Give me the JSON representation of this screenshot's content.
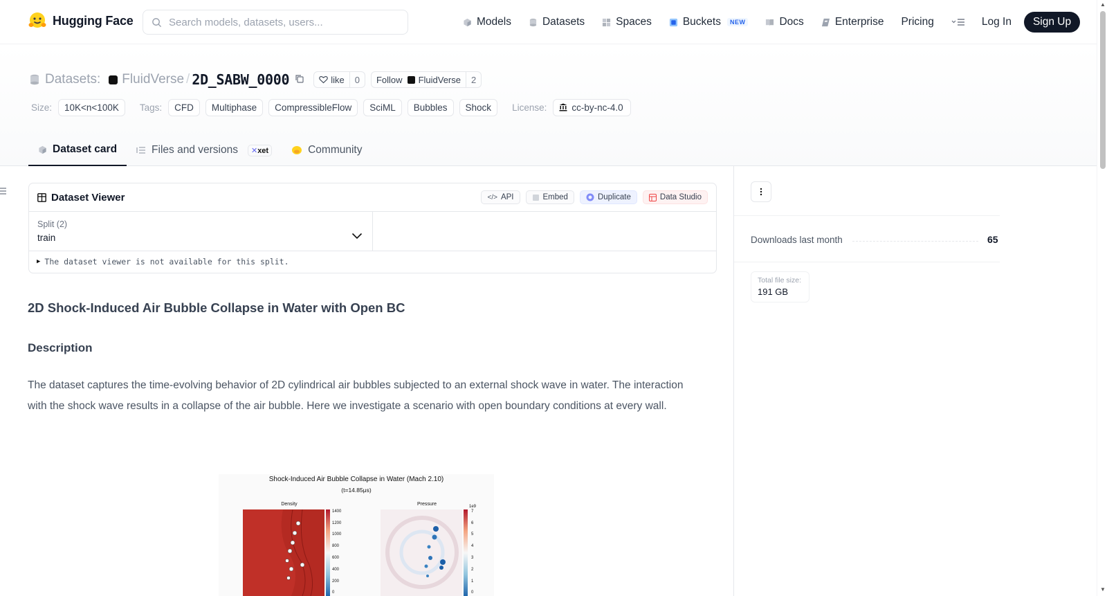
{
  "nav": {
    "brand": "Hugging Face",
    "search_placeholder": "Search models, datasets, users...",
    "links": [
      {
        "label": "Models",
        "icon": "cube-icon"
      },
      {
        "label": "Datasets",
        "icon": "database-icon"
      },
      {
        "label": "Spaces",
        "icon": "grid-icon"
      },
      {
        "label": "Buckets",
        "icon": "bucket-icon",
        "badge": "NEW"
      },
      {
        "label": "Docs",
        "icon": "book-icon"
      },
      {
        "label": "Enterprise",
        "icon": "enterprise-icon"
      },
      {
        "label": "Pricing"
      }
    ],
    "login": "Log In",
    "signup": "Sign Up"
  },
  "repo": {
    "section": "Datasets:",
    "org": "FluidVerse",
    "name": "2D_SABW_0000",
    "like_label": "like",
    "like_count": "0",
    "follow_label": "Follow",
    "follow_org": "FluidVerse",
    "follow_count": "2"
  },
  "tags": {
    "size_label": "Size:",
    "size_value": "10K<n<100K",
    "tags_label": "Tags:",
    "items": [
      "CFD",
      "Multiphase",
      "CompressibleFlow",
      "SciML",
      "Bubbles",
      "Shock"
    ],
    "license_label": "License:",
    "license_value": "cc-by-nc-4.0"
  },
  "tabs": [
    {
      "label": "Dataset card",
      "active": true
    },
    {
      "label": "Files and versions",
      "badge": "xet"
    },
    {
      "label": "Community"
    }
  ],
  "viewer": {
    "title": "Dataset Viewer",
    "buttons": [
      "API",
      "Embed",
      "Duplicate",
      "Data Studio"
    ],
    "split_label": "Split (2)",
    "split_value": "train",
    "message": "The dataset viewer is not available for this split."
  },
  "card": {
    "heading": "2D Shock-Induced Air Bubble Collapse in Water with Open BC",
    "section": "Description",
    "paragraph": "The dataset captures the time-evolving behavior of 2D cylindrical air bubbles subjected to an external shock wave in water. The interaction with the shock wave results in a collapse of the air bubble. Here we investigate a scenario with open boundary conditions at every wall."
  },
  "figure": {
    "title": "Shock-Induced Air Bubble Collapse in Water (Mach 2.10)",
    "subtitle": "(t=14.85μs)",
    "panel1": "Density",
    "panel2": "Pressure",
    "density_ticks": [
      "1400",
      "1200",
      "1000",
      "800",
      "600",
      "400",
      "200",
      "0"
    ],
    "pressure_exp": "1e9",
    "pressure_ticks": [
      "7",
      "6",
      "5",
      "4",
      "3",
      "2",
      "1",
      "0"
    ]
  },
  "sidebar": {
    "downloads_label": "Downloads last month",
    "downloads_value": "65",
    "filesize_label": "Total file size:",
    "filesize_value": "191 GB"
  },
  "colors": {
    "signup_bg": "#111827",
    "accent_blue": "#2563eb",
    "like_border": "#e5e7eb"
  }
}
